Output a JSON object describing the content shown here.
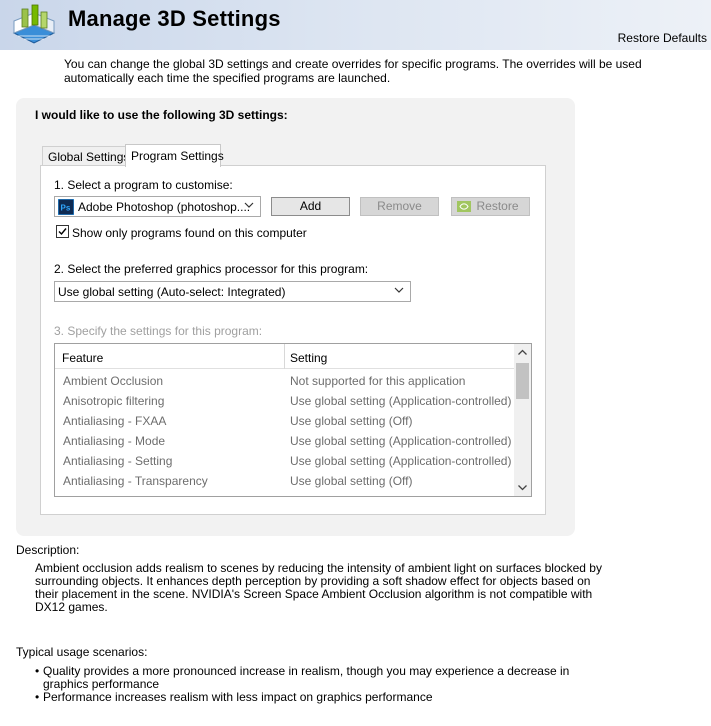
{
  "header": {
    "title": "Manage 3D Settings",
    "restore_defaults": "Restore Defaults"
  },
  "intro": "You can change the global 3D settings and create overrides for specific programs. The overrides will be used automatically each time the specified programs are launched.",
  "panel": {
    "heading": "I would like to use the following 3D settings:",
    "tabs": {
      "global": "Global Settings",
      "program": "Program Settings"
    },
    "program_section": {
      "step1_label": "1. Select a program to customise:",
      "program_value": "Adobe Photoshop (photoshop....",
      "add_label": "Add",
      "remove_label": "Remove",
      "restore_label": "Restore",
      "show_only_label": "Show only programs found on this computer",
      "show_only_checked": true,
      "step2_label": "2. Select the preferred graphics processor for this program:",
      "gpu_value": "Use global setting (Auto-select: Integrated)",
      "step3_label": "3. Specify the settings for this program:"
    },
    "table": {
      "headers": {
        "feature": "Feature",
        "setting": "Setting"
      },
      "rows": [
        {
          "feature": "Ambient Occlusion",
          "setting": "Not supported for this application"
        },
        {
          "feature": "Anisotropic filtering",
          "setting": "Use global setting (Application-controlled)"
        },
        {
          "feature": "Antialiasing - FXAA",
          "setting": "Use global setting (Off)"
        },
        {
          "feature": "Antialiasing - Mode",
          "setting": "Use global setting (Application-controlled)"
        },
        {
          "feature": "Antialiasing - Setting",
          "setting": "Use global setting (Application-controlled)"
        },
        {
          "feature": "Antialiasing - Transparency",
          "setting": "Use global setting (Off)"
        }
      ]
    }
  },
  "description": {
    "heading": "Description:",
    "text": "Ambient occlusion adds realism to scenes by reducing the intensity of ambient light on surfaces blocked by surrounding objects. It enhances depth perception by providing a soft shadow effect for objects based on their placement in the scene. NVIDIA's Screen Space Ambient Occlusion algorithm is not compatible with DX12 games."
  },
  "usage": {
    "heading": "Typical usage scenarios:",
    "items": [
      "Quality provides a more pronounced increase in realism, though you may experience a decrease in graphics performance",
      "Performance increases realism with less impact on graphics performance"
    ]
  },
  "icons": {
    "logo": "nvidia-3d-settings-logo-icon",
    "program": "photoshop-icon",
    "restore": "nvidia-logo-icon",
    "dropdown": "chevron-down-icon",
    "scroll_up": "chevron-up-icon",
    "scroll_down": "chevron-down-icon"
  },
  "colors": {
    "header_gradient_start": "#c9d6ea",
    "panel_bg": "#f2f2f2",
    "disabled_text": "#a0a0a0",
    "photoshop_blue": "#0e2a52",
    "nvidia_green": "#76b900"
  }
}
